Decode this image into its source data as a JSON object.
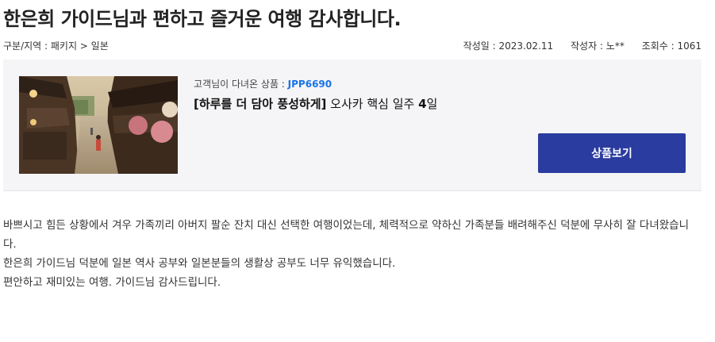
{
  "post": {
    "title": "한은희 가이드님과 편하고 즐거운 여행 감사합니다.",
    "category": "구분/지역 : 패키지 > 일본",
    "date": "작성일 : 2023.02.11",
    "author": "작성자 : 노**",
    "views": "조회수 : 1061"
  },
  "product": {
    "caption_label": "고객님이 다녀온 상품 : ",
    "code": "JPP6690",
    "name_bracket": "[하루를 더 담아 풍성하게]",
    "name_rest": " 오사카 핵심 일주 ",
    "name_days": "4",
    "name_unit": "일",
    "button_label": "상품보기"
  },
  "review": {
    "paragraphs": [
      "바쁘시고 힘든 상황에서 겨우 가족끼리 아버지 팔순 잔치 대신 선택한 여행이었는데, 체력적으로 약하신 가족분들 배려해주신 덕분에 무사히 잘 다녀왔습니다.",
      "한은희  가이드님 덕분에 일본 역사 공부와 일본분들의 생활상 공부도 너무 유익했습니다.",
      "편안하고 재미있는 여행. 가이드님 감사드립니다."
    ]
  }
}
